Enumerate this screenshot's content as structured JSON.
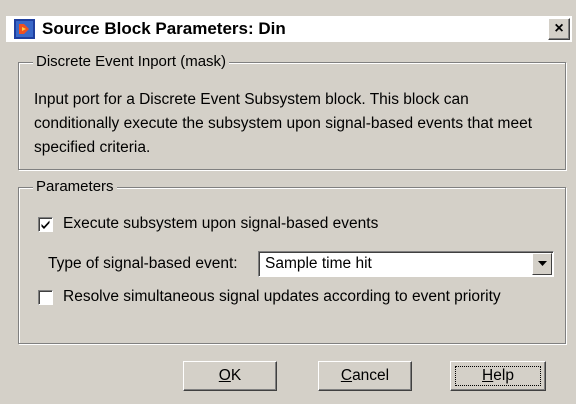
{
  "window": {
    "title": "Source Block Parameters: Din",
    "close_label": "×",
    "app_icon": "simulink-block-icon"
  },
  "mask_group": {
    "legend": "Discrete Event Inport (mask)",
    "description": "Input port for a Discrete Event Subsystem block. This block can conditionally execute the subsystem upon signal-based events that meet specified criteria."
  },
  "parameters_group": {
    "legend": "Parameters",
    "execute_checkbox": {
      "label": "Execute subsystem upon signal-based events",
      "checked": true
    },
    "event_type": {
      "label": "Type of signal-based event:",
      "value": "Sample time hit"
    },
    "resolve_checkbox": {
      "label": "Resolve simultaneous signal updates according to event priority",
      "checked": false
    }
  },
  "buttons": {
    "ok_mnemonic": "O",
    "ok_rest": "K",
    "cancel_mnemonic": "C",
    "cancel_rest": "ancel",
    "help_mnemonic": "H",
    "help_rest": "elp"
  },
  "colors": {
    "dialog_bg": "#d4d0c8",
    "title_bg": "#ffffff"
  }
}
